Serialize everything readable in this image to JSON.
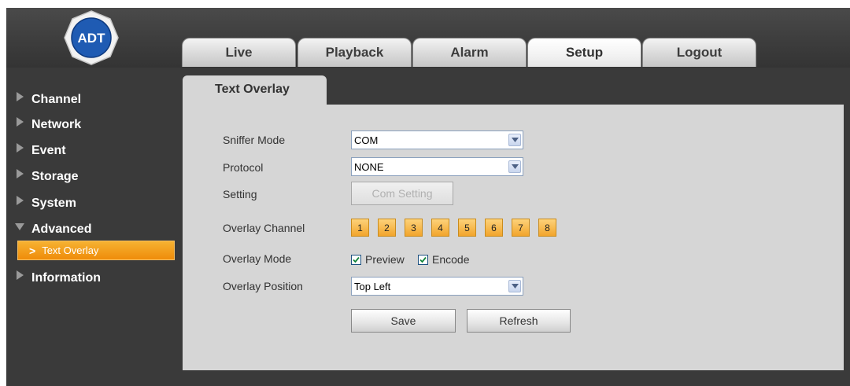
{
  "logo": {
    "text": "ADT"
  },
  "tabs": [
    {
      "label": "Live"
    },
    {
      "label": "Playback"
    },
    {
      "label": "Alarm"
    },
    {
      "label": "Setup",
      "active": true
    },
    {
      "label": "Logout"
    }
  ],
  "sidebar": {
    "items": [
      {
        "label": "Channel"
      },
      {
        "label": "Network"
      },
      {
        "label": "Event"
      },
      {
        "label": "Storage"
      },
      {
        "label": "System"
      },
      {
        "label": "Advanced",
        "expanded": true
      },
      {
        "label": "Information"
      }
    ],
    "sub_item": {
      "label": "Text Overlay",
      "selected": true
    }
  },
  "panel": {
    "title": "Text Overlay",
    "sniffer_mode": {
      "label": "Sniffer Mode",
      "value": "COM"
    },
    "protocol": {
      "label": "Protocol",
      "value": "NONE"
    },
    "setting": {
      "label": "Setting",
      "button": "Com Setting"
    },
    "overlay_channel": {
      "label": "Overlay Channel",
      "channels": [
        "1",
        "2",
        "3",
        "4",
        "5",
        "6",
        "7",
        "8"
      ]
    },
    "overlay_mode": {
      "label": "Overlay Mode",
      "preview": "Preview",
      "encode": "Encode",
      "preview_checked": true,
      "encode_checked": true
    },
    "overlay_position": {
      "label": "Overlay Position",
      "value": "Top Left"
    },
    "save_label": "Save",
    "refresh_label": "Refresh"
  },
  "colors": {
    "accent": "#f29a1d",
    "background": "#3a3a3a",
    "panel": "#d6d6d6",
    "logo_blue": "#1f5bb3"
  }
}
